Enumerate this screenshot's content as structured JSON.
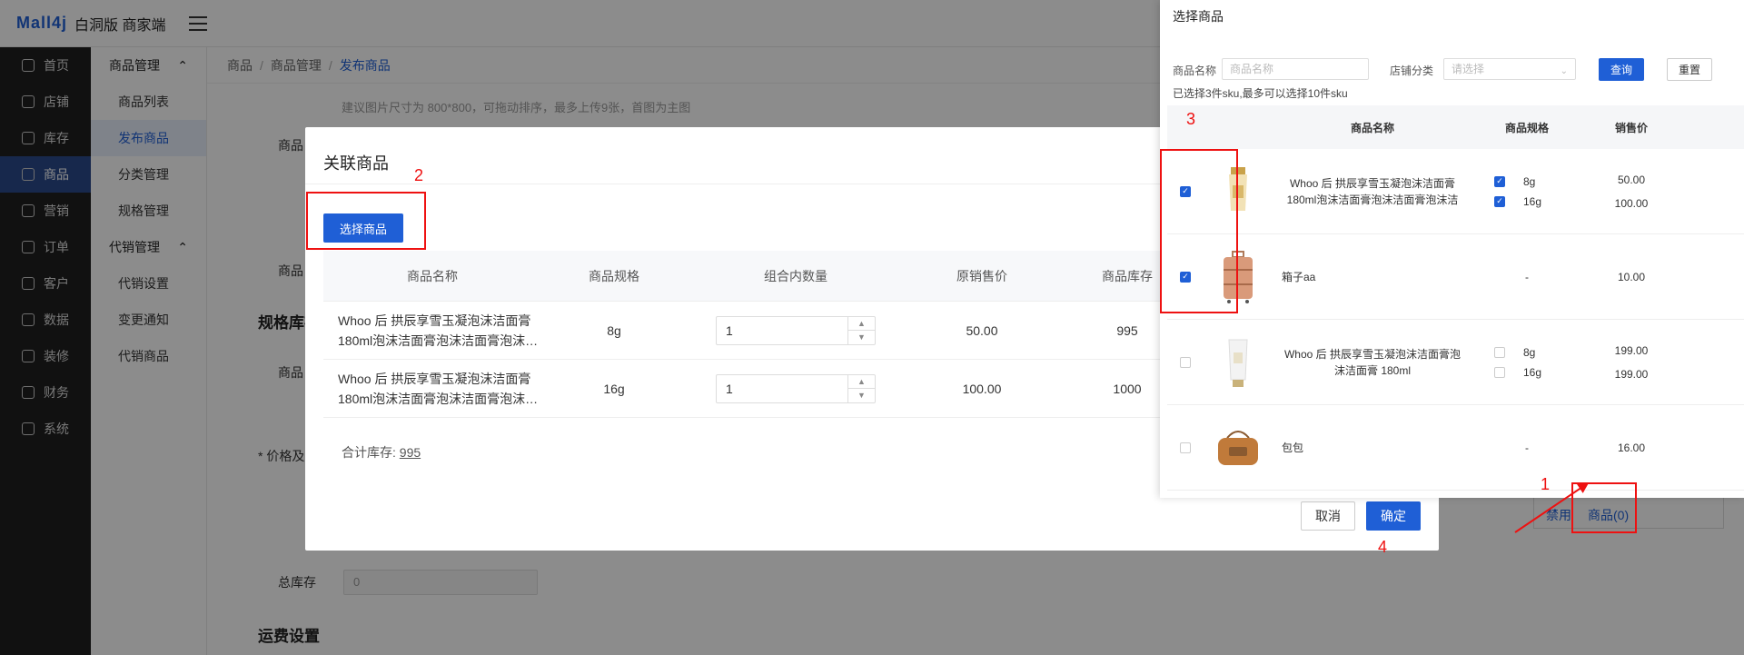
{
  "app": {
    "logo": "Mall4j",
    "edition": "白洞版 商家端"
  },
  "nav": [
    {
      "label": "首页",
      "icon": "home-icon"
    },
    {
      "label": "店铺",
      "icon": "shop-icon"
    },
    {
      "label": "库存",
      "icon": "inventory-icon"
    },
    {
      "label": "商品",
      "icon": "goods-icon",
      "active": true
    },
    {
      "label": "营销",
      "icon": "marketing-icon"
    },
    {
      "label": "订单",
      "icon": "order-icon"
    },
    {
      "label": "客户",
      "icon": "customer-icon"
    },
    {
      "label": "数据",
      "icon": "data-icon"
    },
    {
      "label": "装修",
      "icon": "decorate-icon"
    },
    {
      "label": "财务",
      "icon": "finance-icon"
    },
    {
      "label": "系统",
      "icon": "system-icon"
    }
  ],
  "subnav": {
    "group1": "商品管理",
    "items1": [
      "商品列表",
      "发布商品",
      "分类管理",
      "规格管理"
    ],
    "group2": "代销管理",
    "items2": [
      "代销设置",
      "变更通知",
      "代销商品"
    ]
  },
  "breadcrumb": [
    "商品",
    "商品管理",
    "发布商品"
  ],
  "background": {
    "hint": "建议图片尺寸为 800*800，可拖动排序，最多上传9张，首图为主图",
    "label_goods1": "商品",
    "label_goods2": "商品",
    "label_goods3": "商品",
    "section_spec": "规格库存",
    "label_price": "* 价格及",
    "label_total_stock": "总库存",
    "total_stock_value": "0",
    "section_freight": "运费设置",
    "action_disable": "禁用",
    "action_goods": "商品(0)"
  },
  "modal": {
    "title": "关联商品",
    "select_button": "选择商品",
    "columns": [
      "商品名称",
      "商品规格",
      "组合内数量",
      "原销售价",
      "商品库存"
    ],
    "rows": [
      {
        "name": "Whoo 后 拱辰享雪玉凝泡沫洁面膏 180ml泡沫洁面膏泡沫洁面膏泡沫洁面膏",
        "spec": "8g",
        "qty": "1",
        "price": "50.00",
        "stock": "995"
      },
      {
        "name": "Whoo 后 拱辰享雪玉凝泡沫洁面膏 180ml泡沫洁面膏泡沫洁面膏泡沫洁面膏",
        "spec": "16g",
        "qty": "1",
        "price": "100.00",
        "stock": "1000"
      }
    ],
    "total_label": "合计库存: ",
    "total_value": "995",
    "cancel": "取消",
    "confirm": "确定"
  },
  "panel": {
    "title": "选择商品",
    "name_label": "商品名称",
    "name_placeholder": "商品名称",
    "category_label": "店铺分类",
    "category_placeholder": "请选择",
    "query": "查询",
    "reset": "重置",
    "selected_info": "已选择3件sku,最多可以选择10件sku",
    "columns": [
      "商品名称",
      "商品规格",
      "销售价"
    ],
    "items": [
      {
        "name": "Whoo 后 拱辰享雪玉凝泡沫洁面膏 180ml泡沫洁面膏泡沫洁面膏泡沫洁面膏",
        "checked": true,
        "specs": [
          {
            "spec": "8g",
            "price": "50.00",
            "checked": true
          },
          {
            "spec": "16g",
            "price": "100.00",
            "checked": true
          }
        ],
        "thumb": "cleanser-tube"
      },
      {
        "name": "箱子aa",
        "checked": true,
        "specs": [
          {
            "spec": "-",
            "price": "10.00"
          }
        ],
        "thumb": "suitcase"
      },
      {
        "name": "Whoo 后 拱辰享雪玉凝泡沫洁面膏泡沫洁面膏 180ml",
        "checked": false,
        "specs": [
          {
            "spec": "8g",
            "price": "199.00",
            "checked": false
          },
          {
            "spec": "16g",
            "price": "199.00",
            "checked": false
          }
        ],
        "thumb": "white-tube"
      },
      {
        "name": "包包",
        "checked": false,
        "specs": [
          {
            "spec": "-",
            "price": "16.00"
          }
        ],
        "thumb": "bag"
      }
    ]
  },
  "annotations": [
    "1",
    "2",
    "3",
    "4"
  ],
  "colors": {
    "primary": "#1f5fd6",
    "sidebar": "#1f1f1f",
    "annotation": "#ee1111"
  }
}
